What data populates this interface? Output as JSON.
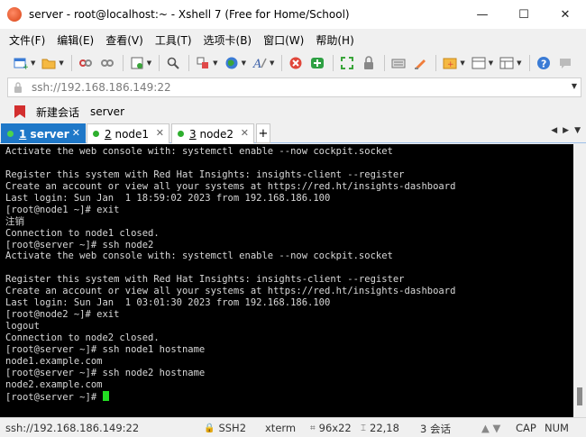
{
  "window": {
    "title": "server - root@localhost:~ - Xshell 7 (Free for Home/School)",
    "controls": {
      "minimize": "—",
      "maximize": "☐",
      "close": "✕"
    }
  },
  "menu": [
    "文件(F)",
    "编辑(E)",
    "查看(V)",
    "工具(T)",
    "选项卡(B)",
    "窗口(W)",
    "帮助(H)"
  ],
  "toolbar": {
    "icons": [
      "new-session",
      "open",
      "disconnect",
      "reconnect",
      "properties",
      "find",
      "transfer",
      "globe",
      "font",
      "xshell",
      "xftp",
      "fullscreen",
      "lock",
      "keyboard",
      "highlight",
      "new-tab",
      "layout",
      "tab-layout",
      "help",
      "chat"
    ]
  },
  "address": {
    "value": "ssh://192.168.186.149:22"
  },
  "sessions": {
    "new_session": "新建会话",
    "server": "server"
  },
  "tabs": [
    {
      "num": "1",
      "name": "server",
      "active": true
    },
    {
      "num": "2",
      "name": "node1",
      "active": false
    },
    {
      "num": "3",
      "name": "node2",
      "active": false
    }
  ],
  "tab_add": "+",
  "terminal": {
    "lines": [
      "Activate the web console with: systemctl enable --now cockpit.socket",
      "",
      "Register this system with Red Hat Insights: insights-client --register",
      "Create an account or view all your systems at https://red.ht/insights-dashboard",
      "Last login: Sun Jan  1 18:59:02 2023 from 192.168.186.100",
      "[root@node1 ~]# exit",
      "注销",
      "Connection to node1 closed.",
      "[root@server ~]# ssh node2",
      "Activate the web console with: systemctl enable --now cockpit.socket",
      "",
      "Register this system with Red Hat Insights: insights-client --register",
      "Create an account or view all your systems at https://red.ht/insights-dashboard",
      "Last login: Sun Jan  1 03:01:30 2023 from 192.168.186.100",
      "[root@node2 ~]# exit",
      "logout",
      "Connection to node2 closed.",
      "[root@server ~]# ssh node1 hostname",
      "node1.example.com",
      "[root@server ~]# ssh node2 hostname",
      "node2.example.com"
    ],
    "prompt": "[root@server ~]# "
  },
  "status": {
    "address": "ssh://192.168.186.149:22",
    "protocol": "SSH2",
    "term": "xterm",
    "size": "96x22",
    "pos": "22,18",
    "sessions": "3 会话",
    "caps": "CAP",
    "num": "NUM"
  }
}
